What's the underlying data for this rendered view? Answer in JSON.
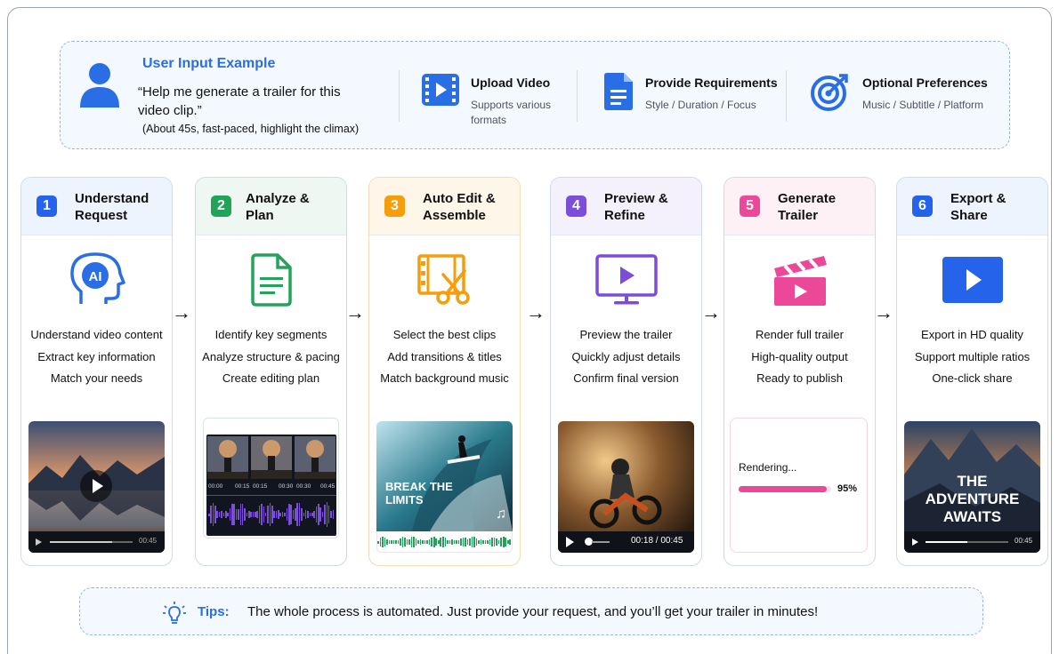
{
  "input": {
    "title": "User Input Example",
    "quote": "“Help me generate a trailer for this video clip.”",
    "note": "(About 45s, fast-paced, highlight the climax)",
    "features": [
      {
        "title": "Upload Video",
        "desc": "Supports various formats",
        "icon": "video-upload-icon"
      },
      {
        "title": "Provide Requirements",
        "desc": "Style / Duration / Focus",
        "icon": "document-icon"
      },
      {
        "title": "Optional Preferences",
        "desc": "Music / Subtitle / Platform",
        "icon": "target-icon"
      }
    ]
  },
  "steps": [
    {
      "num": "1",
      "title": "Understand Request",
      "color": "#2563eb",
      "lines": [
        "Understand video content",
        "Extract key information",
        "Match your needs"
      ],
      "time": "00:45"
    },
    {
      "num": "2",
      "title": "Analyze & Plan",
      "color": "#22a35a",
      "lines": [
        "Identify key segments",
        "Analyze structure & pacing",
        "Create editing plan"
      ],
      "marks": [
        "00:00",
        "00:15",
        "00:15",
        "00:30",
        "00:30",
        "00:45"
      ]
    },
    {
      "num": "3",
      "title": "Auto Edit & Assemble",
      "color": "#f59e0b",
      "lines": [
        "Select the best clips",
        "Add transitions & titles",
        "Match background music"
      ],
      "overlay": "BREAK THE LIMITS"
    },
    {
      "num": "4",
      "title": "Preview & Refine",
      "color": "#7c4dd8",
      "lines": [
        "Preview the trailer",
        "Quickly adjust details",
        "Confirm final version"
      ],
      "time": "00:18 / 00:45"
    },
    {
      "num": "5",
      "title": "Generate Trailer",
      "color": "#ec4899",
      "lines": [
        "Render full trailer",
        "High-quality output",
        "Ready to publish"
      ],
      "render_label": "Rendering...",
      "render_pct": "95%",
      "progress": 0.95
    },
    {
      "num": "6",
      "title": "Export & Share",
      "color": "#2563eb",
      "lines": [
        "Export in HD quality",
        "Support multiple ratios",
        "One-click share"
      ],
      "overlay": "THE ADVENTURE AWAITS",
      "time": "00:45"
    }
  ],
  "tips": {
    "label": "Tips:",
    "text": "The whole process is automated. Just provide your request, and you’ll get your trailer in minutes!"
  },
  "colors": {
    "accent": "#2a6ee6",
    "pink": "#ec4899",
    "green": "#22a35a",
    "orange": "#f59e0b",
    "purple": "#7c4dd8"
  }
}
